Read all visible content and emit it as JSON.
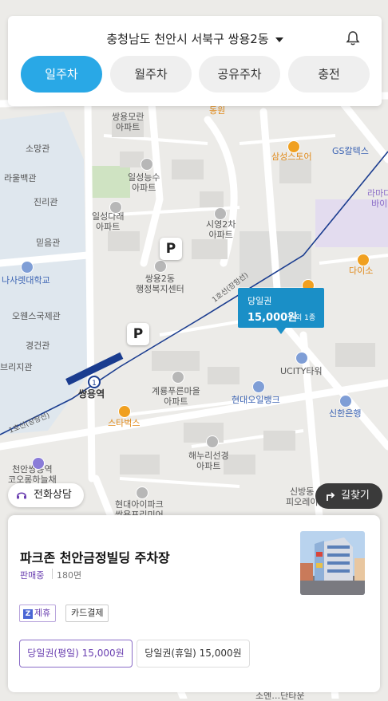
{
  "header": {
    "location": "충청남도 천안시 서북구 쌍용2동",
    "tabs": [
      {
        "label": "일주차",
        "active": true
      },
      {
        "label": "월주차",
        "active": false
      },
      {
        "label": "공유주차",
        "active": false
      },
      {
        "label": "충전",
        "active": false
      }
    ]
  },
  "map": {
    "labels": {
      "ssangyong_moran": "쌍용모란\n아파트",
      "sowang": "소망관",
      "raulbaek": "라울백관",
      "jinri": "진리관",
      "mideum": "믿음관",
      "nasaret": "나사렛대학교",
      "osen": "오웬스국제관",
      "gyeongjeon": "경건관",
      "brijigwan": "브리지관",
      "ilseong_neungsu": "일성능수\n아파트",
      "ilseong_dareh": "일성다래\n아파트",
      "siyeong2": "시영2차\n아파트",
      "ssangyong2_center": "쌍용2동\n행정복지센터",
      "line1_a": "1호선(장항선)",
      "line1_b": "1호선(장항선)",
      "samsung": "삼성스토어",
      "gs": "GS칼텍스",
      "lamaison": "라마다\n바이",
      "daiso": "다이소",
      "ucity": "UCITY타워",
      "hyundai_oil": "현대오일뱅크",
      "shinhan": "신한은행",
      "gyeryong": "계룡푸른마을\n아파트",
      "ssangyong_station": "쌍용역",
      "starbucks": "스타벅스",
      "haenuri": "해누리선경\n아파트",
      "hyundai_i": "현대아이파크\n쌍용프리미어",
      "sinbang": "신방동\n피오레이",
      "cheonan_church": "천안쌍용역\n코오롱하늘채",
      "dong_top": "동원",
      "bottom_apt": "소엔…단타운"
    },
    "parking_marker": "P",
    "price_tag": {
      "type": "당일권",
      "price": "15,000원",
      "extra": "외 1종"
    }
  },
  "buttons": {
    "call": "전화상담",
    "directions": "길찾기"
  },
  "sheet": {
    "name": "파크존 천안금정빌딩 주차장",
    "status": "판매중",
    "spaces": "180면",
    "tags": {
      "partner": "제휴",
      "partner_icon": "Z",
      "card": "카드결제"
    },
    "prices": [
      {
        "label": "당일권(평일) 15,000원",
        "selected": true
      },
      {
        "label": "당일권(휴일) 15,000원",
        "selected": false
      }
    ]
  },
  "colors": {
    "accent": "#29a8e6",
    "price_tag": "#1a8fc7",
    "status_purple": "#6a3fb0",
    "subway_line": "#1a3c8f"
  }
}
